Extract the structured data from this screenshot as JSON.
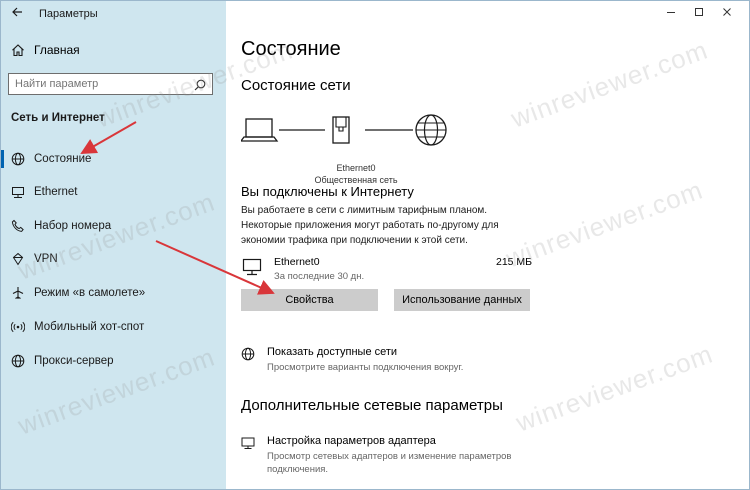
{
  "window": {
    "title": "Параметры",
    "back_icon": "back-arrow-icon"
  },
  "sidebar": {
    "home_label": "Главная",
    "search_placeholder": "Найти параметр",
    "section_heading": "Сеть и Интернет",
    "items": [
      {
        "label": "Состояние",
        "icon": "globe-icon",
        "active": true
      },
      {
        "label": "Ethernet",
        "icon": "ethernet-icon"
      },
      {
        "label": "Набор номера",
        "icon": "phone-icon"
      },
      {
        "label": "VPN",
        "icon": "vpn-icon"
      },
      {
        "label": "Режим «в самолете»",
        "icon": "airplane-icon"
      },
      {
        "label": "Мобильный хот-спот",
        "icon": "hotspot-icon"
      },
      {
        "label": "Прокси-сервер",
        "icon": "globe-icon"
      }
    ]
  },
  "main": {
    "page_title": "Состояние",
    "network_status_heading": "Состояние сети",
    "connection": {
      "adapter": "Ethernet0",
      "network_type": "Общественная сеть"
    },
    "connected_title": "Вы подключены к Интернету",
    "connected_description": "Вы работаете в сети с лимитным тарифным планом. Некоторые приложения могут работать по-другому для экономии трафика при подключении к этой сети.",
    "usage": {
      "name": "Ethernet0",
      "period": "За последние 30 дн.",
      "size": "215 МБ"
    },
    "buttons": {
      "properties": "Свойства",
      "data_usage": "Использование данных"
    },
    "show_networks": {
      "title": "Показать доступные сети",
      "description": "Просмотрите варианты подключения вокруг."
    },
    "advanced_heading": "Дополнительные сетевые параметры",
    "adapter_settings": {
      "title": "Настройка параметров адаптера",
      "description": "Просмотр сетевых адаптеров и изменение параметров подключения."
    }
  },
  "watermark_text": "winreviewer.com",
  "colors": {
    "sidebar_bg": "#cfe6ef",
    "accent": "#0063b1",
    "button_bg": "#cccccc",
    "arrow": "#d9363a"
  }
}
